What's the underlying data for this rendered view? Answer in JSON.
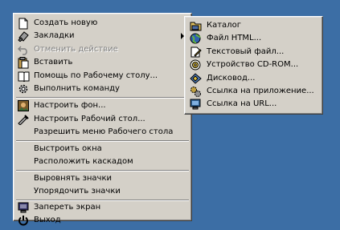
{
  "context_menu": {
    "items": [
      {
        "label": "Создать новую",
        "icon": "new-document-icon"
      },
      {
        "label": "Закладки",
        "icon": "bookmark-icon",
        "submenu": true
      },
      {
        "label": "Отменить действие",
        "icon": "undo-icon",
        "disabled": true
      },
      {
        "label": "Вставить",
        "icon": "paste-icon"
      },
      {
        "label": "Помощь по Рабочему столу...",
        "icon": "help-book-icon"
      },
      {
        "label": "Выполнить команду",
        "icon": "run-gear-icon"
      },
      {
        "label": "Настроить фон...",
        "icon": "wallpaper-icon"
      },
      {
        "label": "Настроить Рабочий стол...",
        "icon": "desktop-settings-icon"
      },
      {
        "label": "Разрешить меню Рабочего стола"
      },
      {
        "label": "Выстроить окна"
      },
      {
        "label": "Расположить каскадом"
      },
      {
        "label": "Выровнять значки"
      },
      {
        "label": "Упорядочить значки"
      },
      {
        "label": "Запереть экран",
        "icon": "lock-screen-icon"
      },
      {
        "label": "Выход",
        "icon": "power-icon"
      }
    ]
  },
  "bookmarks_submenu": {
    "items": [
      {
        "label": "Каталог",
        "icon": "folder-icon"
      },
      {
        "label": "Файл HTML...",
        "icon": "globe-icon"
      },
      {
        "label": "Текстовый файл...",
        "icon": "text-file-icon"
      },
      {
        "label": "Устройство CD-ROM...",
        "icon": "cdrom-icon"
      },
      {
        "label": "Дисковод...",
        "icon": "floppy-icon"
      },
      {
        "label": "Ссылка на приложение...",
        "icon": "app-link-icon"
      },
      {
        "label": "Ссылка на URL...",
        "icon": "url-link-icon"
      }
    ]
  },
  "colors": {
    "desktop": "#3c6ea5",
    "menu": "#d4d0c8"
  }
}
